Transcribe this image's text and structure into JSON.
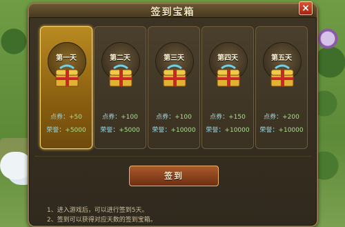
{
  "dialog": {
    "title": "签到宝箱",
    "close_label": "×",
    "sign_button": "签到",
    "notes": [
      "1、进入游戏后，可以进行签到5天。",
      "2、签到可以获得对应天数的签到宝箱。"
    ]
  },
  "days": [
    {
      "day": "第一天",
      "points_label": "点券：",
      "points": "+50",
      "honor_label": "荣誉：",
      "honor": "+5000",
      "active": true
    },
    {
      "day": "第二天",
      "points_label": "点券：",
      "points": "+100",
      "honor_label": "荣誉：",
      "honor": "+5000",
      "active": false
    },
    {
      "day": "第三天",
      "points_label": "点券：",
      "points": "+100",
      "honor_label": "荣誉：",
      "honor": "+10000",
      "active": false
    },
    {
      "day": "第四天",
      "points_label": "点券：",
      "points": "+150",
      "honor_label": "荣誉：",
      "honor": "+10000",
      "active": false
    },
    {
      "day": "第五天",
      "points_label": "点券：",
      "points": "+200",
      "honor_label": "荣誉：",
      "honor": "+10000",
      "active": false
    }
  ],
  "colors": {
    "accent": "#ffd668",
    "panel": "#3d3424",
    "close": "#c0321a"
  }
}
